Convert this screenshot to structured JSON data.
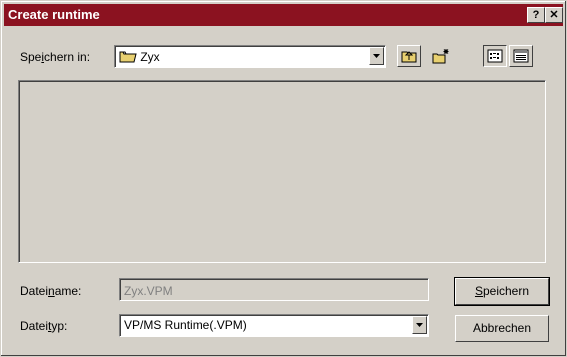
{
  "window": {
    "title": "Create runtime",
    "help_label": "?",
    "close_label": "✕"
  },
  "location": {
    "label_pre": "Spe",
    "label_key": "i",
    "label_post": "chern in:",
    "value": "Zyx"
  },
  "toolbar": {
    "icons": [
      "folder-up-icon",
      "new-folder-icon",
      "list-view-icon",
      "details-view-icon"
    ]
  },
  "filename": {
    "label_pre": "Datei",
    "label_key": "n",
    "label_post": "ame:",
    "value": "Zyx.VPM"
  },
  "filetype": {
    "label_pre": "Datei",
    "label_key": "t",
    "label_post": "yp:",
    "value": "VP/MS Runtime(.VPM)"
  },
  "buttons": {
    "save_key": "S",
    "save_rest": "peichern",
    "cancel": "Abbrechen"
  },
  "colors": {
    "titlebar": "#8b1220",
    "face": "#d4d0c8",
    "folder": "#e8d070"
  }
}
